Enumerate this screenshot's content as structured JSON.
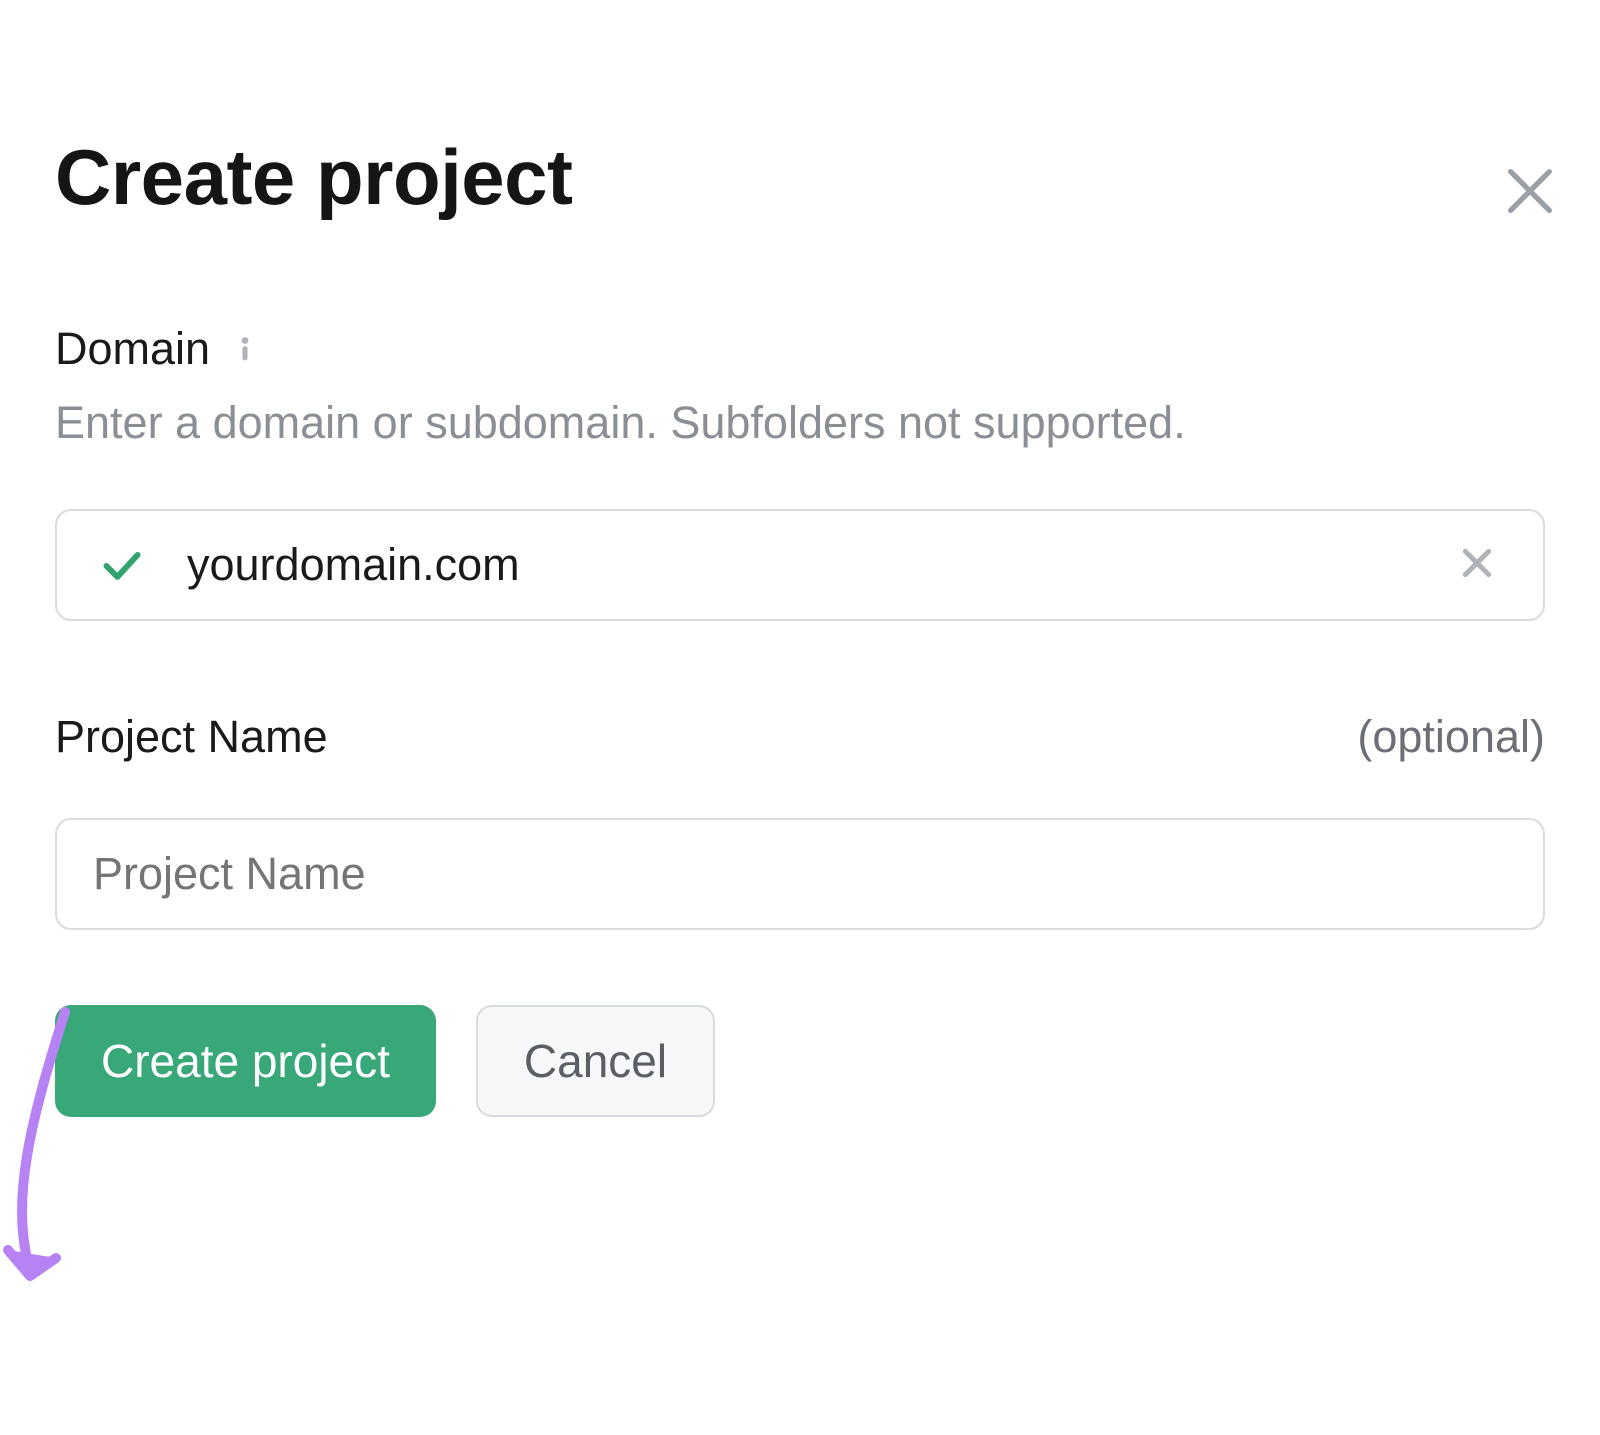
{
  "modal": {
    "title": "Create project",
    "close_aria": "Close"
  },
  "domain_field": {
    "label": "Domain",
    "helper": "Enter a domain or subdomain. Subfolders not supported.",
    "value": "yourdomain.com",
    "clear_aria": "Clear"
  },
  "project_name_field": {
    "label": "Project Name",
    "optional_label": "(optional)",
    "placeholder": "Project Name",
    "value": ""
  },
  "actions": {
    "primary_label": "Create project",
    "secondary_label": "Cancel"
  },
  "colors": {
    "primary_button": "#38a879",
    "check_green": "#31a36c",
    "annotation_purple": "#b782f3",
    "muted_text": "#8a8f95",
    "border": "#d8dbdf"
  }
}
